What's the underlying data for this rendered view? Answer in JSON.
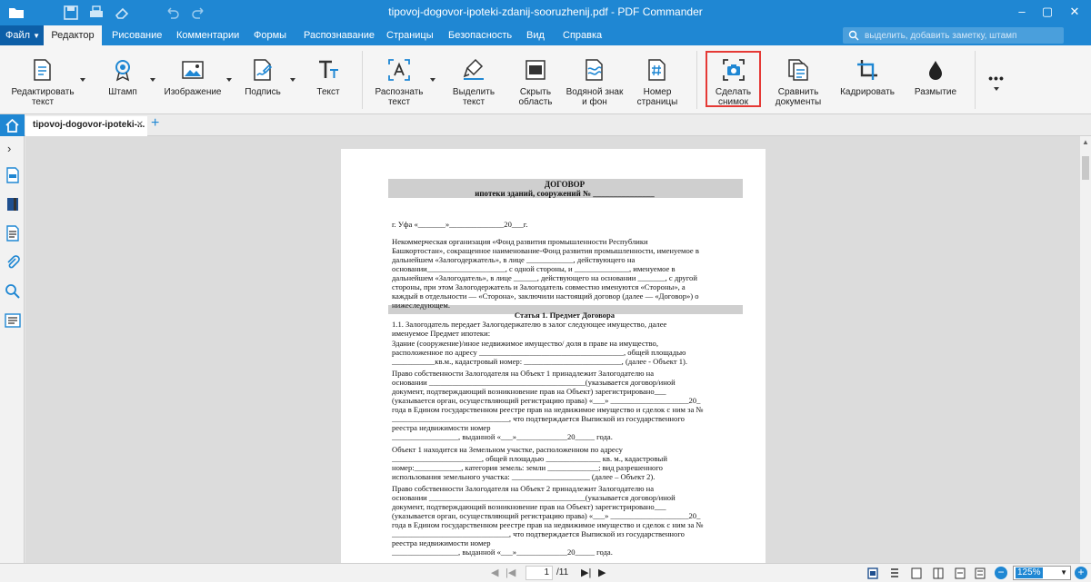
{
  "window": {
    "title": "tipovoj-dogovor-ipoteki-zdanij-sooruzhenij.pdf - PDF Commander"
  },
  "menu": {
    "file": "Файл",
    "tabs": [
      "Редактор",
      "Рисование",
      "Комментарии",
      "Формы",
      "Распознавание",
      "Страницы",
      "Безопасность",
      "Вид",
      "Справка"
    ],
    "search_placeholder": "выделить, добавить заметку, штамп"
  },
  "toolbar": {
    "edit_text": "Редактировать\nтекст",
    "stamp": "Штамп",
    "image": "Изображение",
    "signature": "Подпись",
    "text": "Текст",
    "recognize_text": "Распознать\nтекст",
    "highlight_text": "Выделить\nтекст",
    "hide_area": "Скрыть\nобласть",
    "watermark": "Водяной знак\nи фон",
    "page_number": "Номер\nстраницы",
    "snapshot": "Сделать\nснимок",
    "compare": "Сравнить\nдокументы",
    "crop": "Кадрировать",
    "blur": "Размытие",
    "more": "•••"
  },
  "tabs": {
    "doc_tab": "tipovoj-dogovor-ipoteki-...",
    "close": "✕",
    "add": "+"
  },
  "document": {
    "title": "ДОГОВОР",
    "subtitle": "ипотеки зданий, сооружений № _______________",
    "lines": [
      "г. Уфа                                                                  «_______»______________20___г.",
      "        Некоммерческая организация «Фонд развития промышленности Республики",
      "Башкортостан», сокращенное наименование-Фонд развития промышленности, именуемое в",
      "дальнейшем         «Залогодержатель»,         в         лице         ____________,         действующего         на",
      "основании____________________, с одной стороны, и ______________, именуемое в",
      "дальнейшем «Залогодатель», в лице ______, действующего на основании _______, с другой",
      "стороны, при этом Залогодержатель и Залогодатель совместно именуются «Стороны», а",
      "каждый в отдельности — «Сторона», заключили настоящий договор (далее — «Договор») о",
      "нижеследующем.",
      "Статья 1. Предмет Договора",
      "        1.1. Залогодатель передает Залогодержателю в залог следующее имущество, далее",
      "именуемое Предмет ипотеки:",
      "        Здание (сооружение)/иное недвижимое имущество/ доля в праве на имущество,",
      "расположенное по адресу _____________________________________, общей площадью",
      "___________кв.м., кадастровый номер: _________________________, (далее - Объект 1).",
      "        Право собственности Залогодателя на Объект 1 принадлежит Залогодателю на",
      "основании ________________________________________(указывается договор/иной",
      "документ, подтверждающий возникновение прав на Объект) зарегистрировано___",
      "(указывается орган, осуществляющий регистрацию права) «___» ____________________20_",
      "года в Едином государственном реестре прав на недвижимое имущество и сделок с ним за №",
      "______________________________, что подтверждается Выпиской из государственного",
      "реестра недвижимости номер",
      "_________________, выданной «___»_____________20_____ года.",
      "        Объект 1 находится на Земельном участке, расположенном по адресу",
      "_______________________,  общей  площадью  ______________  кв.  м.,  кадастровый",
      "номер:____________, категория земель: земли _____________;  вид  разрешенного",
      "использования земельного участка: ____________________ (далее – Объект 2).",
      "        Право собственности Залогодателя на Объект 2 принадлежит Залогодателю на",
      "основании ________________________________________(указывается договор/иной",
      "документ, подтверждающий возникновение прав на Объект) зарегистрировано___",
      "(указывается орган, осуществляющий регистрацию права) «___» ____________________20_",
      "года в Едином государственном реестре прав на недвижимое имущество и сделок с ним за №",
      "______________________________, что подтверждается Выпиской из государственного",
      "реестра недвижимости номер",
      "_________________, выданной «___»_____________20_____ года."
    ]
  },
  "status": {
    "page_current": "1",
    "page_total": "/11",
    "zoom": "125%"
  },
  "colors": {
    "accent": "#1f87d3",
    "highlight": "#e53935"
  }
}
